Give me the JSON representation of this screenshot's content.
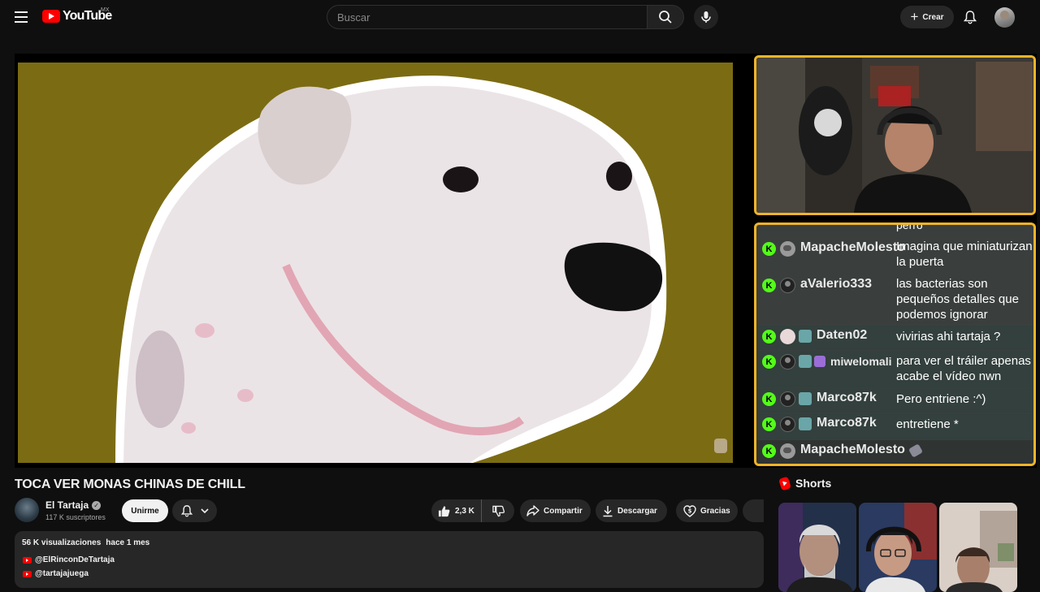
{
  "header": {
    "logo_text": "YouTube",
    "country_code": "MX",
    "search_placeholder": "Buscar",
    "create_label": "Crear"
  },
  "video": {
    "title": "TOCA VER MONAS CHINAS DE CHILL",
    "channel_name": "El Tartaja",
    "subscribers": "117 K suscriptores",
    "join_label": "Unirme",
    "likes": "2,3 K",
    "share_label": "Compartir",
    "download_label": "Descargar",
    "thanks_label": "Gracias"
  },
  "description": {
    "views": "56 K visualizaciones",
    "age": "hace 1 mes",
    "links": [
      "@ElRinconDeTartaja",
      "@tartajajuega"
    ]
  },
  "chat_overlay": {
    "cut_text": "perro",
    "messages": [
      {
        "user": "MapacheMolesto",
        "text": "Imagina que miniaturizan la puerta"
      },
      {
        "user": "aValerio333",
        "text": "las bacterias son pequeños detalles que podemos ignorar"
      },
      {
        "user": "Daten02",
        "text": "vivirias ahi tartaja ?"
      },
      {
        "user": "miwelomali",
        "text": "para ver el tráiler apenas acabe el vídeo nwn"
      },
      {
        "user": "Marco87k",
        "text": "Pero entriene :^)"
      },
      {
        "user": "Marco87k",
        "text": "entretiene *"
      },
      {
        "user": "MapacheMolesto",
        "text": ""
      }
    ]
  },
  "shorts": {
    "heading": "Shorts"
  },
  "colors": {
    "brand_red": "#ff0000",
    "overlay_border": "#f0b429",
    "kick_green": "#53fc18"
  }
}
